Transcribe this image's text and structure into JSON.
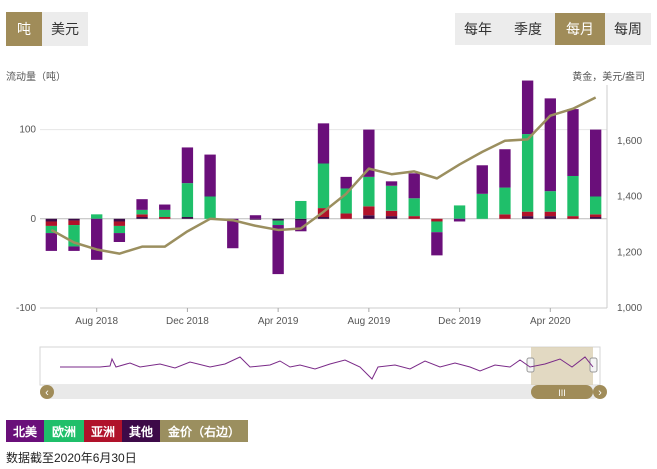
{
  "unit_toggle": {
    "tonnes_label": "吨",
    "usd_label": "美元",
    "active": "tonnes"
  },
  "period_tabs": {
    "items": [
      {
        "label": "每年"
      },
      {
        "label": "季度"
      },
      {
        "label": "每月"
      },
      {
        "label": "每周"
      }
    ],
    "active_index": 2
  },
  "colors": {
    "north_america": "#6a0f7a",
    "europe": "#1fbf6a",
    "asia": "#b0122a",
    "other": "#3d0a48",
    "gold": "#9b8f5f",
    "accent": "#a08c59"
  },
  "chart_data": {
    "type": "bar",
    "ylabel": "流动量（吨）",
    "y2label": "黄金，美元/盎司",
    "ylim": [
      -100,
      150
    ],
    "y2lim": [
      1000,
      1800
    ],
    "yticks": [
      -100,
      0,
      100
    ],
    "y2ticks": [
      "1,000",
      "1,200",
      "1,400",
      "1,600"
    ],
    "x_tick_labels": [
      "Aug 2018",
      "Dec 2018",
      "Apr 2019",
      "Aug 2019",
      "Dec 2019",
      "Apr 2020"
    ],
    "x_tick_index": [
      2,
      6,
      10,
      14,
      18,
      22
    ],
    "categories": [
      "2018-06",
      "2018-07",
      "2018-08",
      "2018-09",
      "2018-10",
      "2018-11",
      "2018-12",
      "2019-01",
      "2019-02",
      "2019-03",
      "2019-04",
      "2019-05",
      "2019-06",
      "2019-07",
      "2019-08",
      "2019-09",
      "2019-10",
      "2019-11",
      "2019-12",
      "2020-01",
      "2020-02",
      "2020-03",
      "2020-04",
      "2020-05",
      "2020-06"
    ],
    "series": [
      {
        "name": "北美",
        "values": [
          -20,
          -5,
          -46,
          -10,
          12,
          6,
          40,
          47,
          -33,
          4,
          -55,
          -12,
          45,
          13,
          53,
          5,
          28,
          -26,
          -3,
          32,
          43,
          60,
          104,
          75,
          75
        ]
      },
      {
        "name": "欧洲",
        "values": [
          -8,
          -24,
          5,
          -8,
          5,
          8,
          38,
          25,
          0,
          0,
          -5,
          20,
          50,
          28,
          33,
          28,
          20,
          -12,
          15,
          28,
          30,
          87,
          23,
          45,
          20
        ]
      },
      {
        "name": "亚洲",
        "values": [
          -5,
          -5,
          0,
          -5,
          3,
          2,
          0,
          0,
          0,
          0,
          0,
          0,
          10,
          6,
          10,
          6,
          3,
          -3,
          0,
          0,
          5,
          5,
          5,
          3,
          3
        ]
      },
      {
        "name": "其他",
        "values": [
          -3,
          -2,
          0,
          -3,
          2,
          0,
          2,
          0,
          0,
          -1,
          -2,
          -2,
          2,
          0,
          4,
          3,
          0,
          0,
          0,
          0,
          0,
          3,
          3,
          0,
          2
        ]
      }
    ],
    "gold_series": {
      "name": "金价（右边）",
      "values": [
        1280,
        1235,
        1210,
        1195,
        1220,
        1220,
        1275,
        1320,
        1315,
        1295,
        1280,
        1285,
        1345,
        1410,
        1500,
        1480,
        1490,
        1465,
        1515,
        1560,
        1600,
        1605,
        1690,
        1715,
        1755
      ]
    },
    "legend": [
      "北美",
      "欧洲",
      "亚洲",
      "其他",
      "金价（右边）"
    ]
  },
  "footnote": "数据截至2020年6月30日",
  "navigator": {
    "handle_label": "III",
    "left_arrow": "‹",
    "right_arrow": "›"
  }
}
